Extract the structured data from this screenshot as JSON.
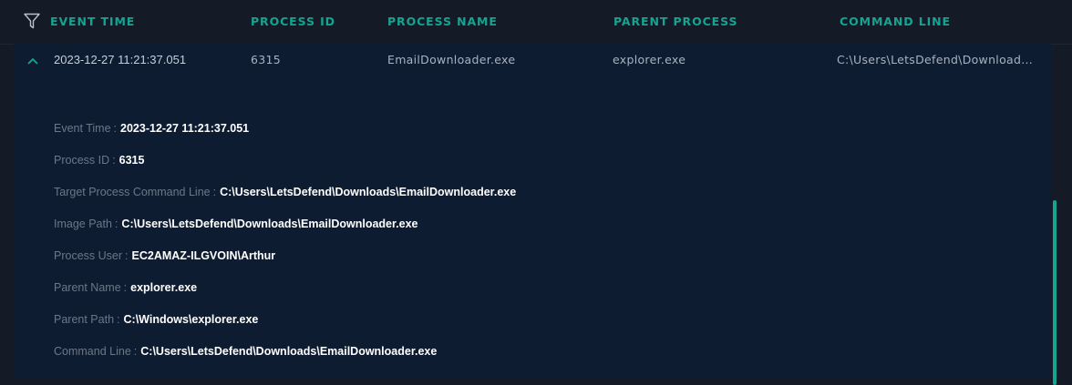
{
  "header": {
    "columns": [
      "EVENT TIME",
      "PROCESS ID",
      "PROCESS NAME",
      "PARENT PROCESS",
      "COMMAND LINE"
    ]
  },
  "row": {
    "event_time": "2023-12-27 11:21:37.051",
    "process_id": "6315",
    "process_name": "EmailDownloader.exe",
    "parent_process": "explorer.exe",
    "command_line": "C:\\Users\\LetsDefend\\Download..."
  },
  "details": [
    {
      "label": "Event Time",
      "value": "2023-12-27 11:21:37.051"
    },
    {
      "label": "Process ID",
      "value": "6315"
    },
    {
      "label": "Target Process Command Line",
      "value": "C:\\Users\\LetsDefend\\Downloads\\EmailDownloader.exe"
    },
    {
      "label": "Image Path",
      "value": "C:\\Users\\LetsDefend\\Downloads\\EmailDownloader.exe"
    },
    {
      "label": "Process User",
      "value": "EC2AMAZ-ILGVOIN\\Arthur"
    },
    {
      "label": "Parent Name",
      "value": "explorer.exe"
    },
    {
      "label": "Parent Path",
      "value": "C:\\Windows\\explorer.exe"
    },
    {
      "label": "Command Line",
      "value": "C:\\Users\\LetsDefend\\Downloads\\EmailDownloader.exe"
    }
  ],
  "colors": {
    "accent": "#13a591",
    "background": "#141b26",
    "row_background": "#0e1c32"
  },
  "icons": {
    "filter": "filter-icon",
    "collapse": "chevron-up-icon"
  }
}
